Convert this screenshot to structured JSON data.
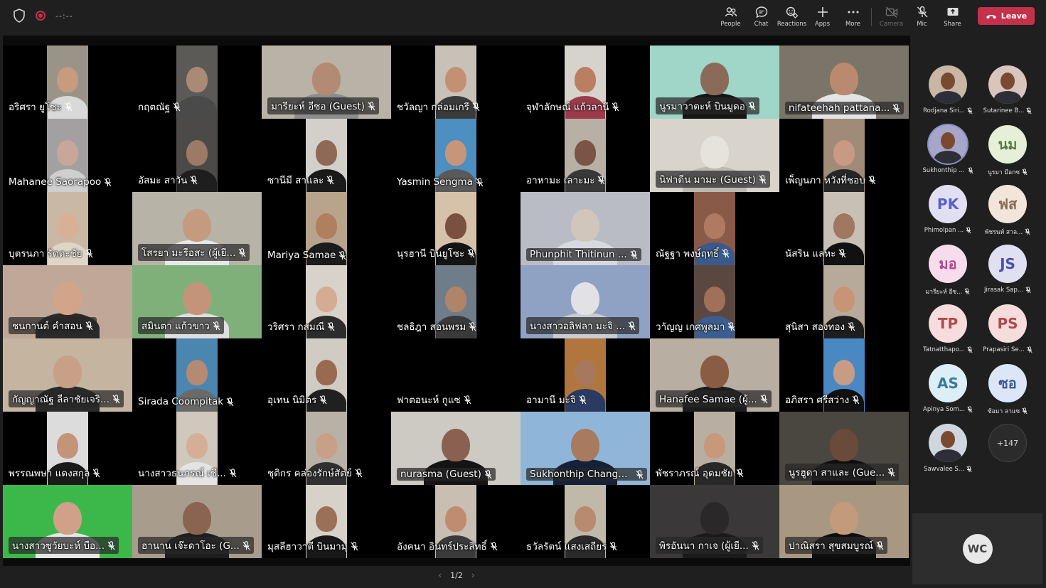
{
  "top_bar": {
    "timer": "--:--",
    "actions": [
      {
        "key": "people",
        "label": "People",
        "icon": "people-icon",
        "enabled": true
      },
      {
        "key": "chat",
        "label": "Chat",
        "icon": "chat-icon",
        "enabled": true
      },
      {
        "key": "reactions",
        "label": "Reactions",
        "icon": "reactions-icon",
        "enabled": true
      },
      {
        "key": "apps",
        "label": "Apps",
        "icon": "plus-icon",
        "enabled": true
      },
      {
        "key": "more",
        "label": "More",
        "icon": "more-icon",
        "enabled": true
      },
      {
        "key": "camera",
        "label": "Camera",
        "icon": "camera-off-icon",
        "enabled": false
      },
      {
        "key": "mic",
        "label": "Mic",
        "icon": "mic-off-icon",
        "enabled": true
      },
      {
        "key": "share",
        "label": "Share",
        "icon": "share-icon",
        "enabled": true
      }
    ],
    "leave_label": "Leave"
  },
  "colors": {
    "background": "#1f1f1f",
    "stage": "#0b0b0b",
    "leave": "#c4314b",
    "ring": "#8b8cc7"
  },
  "participants": [
    {
      "name": "อริศรา ยูโซะ",
      "wide": false,
      "bg": "#9a9488",
      "skin": "#c89a7e",
      "cloth": "#d9d9d9"
    },
    {
      "name": "กฤตณัฐ",
      "wide": false,
      "bg": "#5b5a57",
      "skin": "#a88a76",
      "cloth": "#4a4a4a"
    },
    {
      "name": "มารียะห์ อีซอ (Guest)",
      "wide": true,
      "bg": "#b9b2a6",
      "skin": "#b38a74",
      "cloth": "#8c8c8c"
    },
    {
      "name": "ชวัลญา กล่อมเกรี",
      "wide": false,
      "bg": "#c7c1b8",
      "skin": "#c49072",
      "cloth": "#3a3a3a"
    },
    {
      "name": "จุฬาลักษณ์ แก้วลานี",
      "wide": false,
      "bg": "#d6d2cc",
      "skin": "#b97f60",
      "cloth": "#9a3a4a"
    },
    {
      "name": "นูรมาวาตะห์ บินมูดอ",
      "wide": true,
      "bg": "#9fd6c8",
      "skin": "#8a6a58",
      "cloth": "#151515"
    },
    {
      "name": "nifateehah pattana...",
      "wide": true,
      "bg": "#7b7468",
      "skin": "#b98a70",
      "cloth": "#e4e4e4"
    },
    {
      "name": "Mahanee Saorapoo",
      "wide": false,
      "bg": "#a3a0a2",
      "skin": "#c8a79a",
      "cloth": "#cfcfcf"
    },
    {
      "name": "อัสมะ สาวัน",
      "wide": false,
      "bg": "#4c4a48",
      "skin": "#9c7a66",
      "cloth": "#1e1e1e"
    },
    {
      "name": "ซานีมี สาและ",
      "wide": false,
      "bg": "#d3d0cb",
      "skin": "#8e6a56",
      "cloth": "#1a1a1a"
    },
    {
      "name": "Yasmin Sengma",
      "wide": false,
      "bg": "#4c8fc0",
      "skin": "#c7967a",
      "cloth": "#5a5a5a"
    },
    {
      "name": "อาหามะ เลาะมะ",
      "wide": false,
      "bg": "#b8b0a4",
      "skin": "#7a5444",
      "cloth": "#383838"
    },
    {
      "name": "นิฟาดีน มามะ (Guest)",
      "wide": true,
      "bg": "#d8d4cc",
      "skin": "#e6e2dc",
      "cloth": "#bdb8b0"
    },
    {
      "name": "เพ็ญนภา หวังที่ชอบ",
      "wide": false,
      "bg": "#a08a78",
      "skin": "#c89a84",
      "cloth": "#262626"
    },
    {
      "name": "บุตรนภา รัตตะชัย",
      "wide": false,
      "bg": "#c8b8a4",
      "skin": "#d8b094",
      "cloth": "#e0d6c8"
    },
    {
      "name": "โสรยา มะรือสะ (ผู้เยี...",
      "wide": true,
      "bg": "#b7b3a6",
      "skin": "#c49a80",
      "cloth": "#e8e8e8"
    },
    {
      "name": "Mariya Samae",
      "wide": false,
      "bg": "#b8a48c",
      "skin": "#b0805e",
      "cloth": "#1c1c1c"
    },
    {
      "name": "นุรฮานี บินยูโซะ",
      "wide": false,
      "bg": "#d6c2a8",
      "skin": "#7a5040",
      "cloth": "#141414"
    },
    {
      "name": "Phunphit Thitinun ...",
      "wide": true,
      "bg": "#b9bcc4",
      "skin": "#d0c6bc",
      "cloth": "#d8d8e0"
    },
    {
      "name": "ณัฐฐา พงษ์ฤทธิ์",
      "wide": false,
      "bg": "#8a5a48",
      "skin": "#b07a62",
      "cloth": "#3a5a8a"
    },
    {
      "name": "นัสริน แลหะ",
      "wide": false,
      "bg": "#c8c0b4",
      "skin": "#a07860",
      "cloth": "#111111"
    },
    {
      "name": "ชนกานต์ คำสอน",
      "wide": true,
      "bg": "#c0a898",
      "skin": "#d2a48a",
      "cloth": "#2a2a2a"
    },
    {
      "name": "สมินตา แก้วขาว",
      "wide": true,
      "bg": "#7fb07a",
      "skin": "#c4947a",
      "cloth": "#dedede"
    },
    {
      "name": "วริศรา กสมณี",
      "wide": false,
      "bg": "#d8d2ca",
      "skin": "#d4ac94",
      "cloth": "#2c2c2c"
    },
    {
      "name": "ชลธิฎา สอนพรม",
      "wide": false,
      "bg": "#6f7d8a",
      "skin": "#b08468",
      "cloth": "#3a3a3a"
    },
    {
      "name": "นางสาวอลิฟลา มะจิ ...",
      "wide": true,
      "bg": "#8fa2c4",
      "skin": "#e2e2e6",
      "cloth": "#c8ccd4"
    },
    {
      "name": "วาัญญ เกศพูลมา",
      "wide": false,
      "bg": "#5a4840",
      "skin": "#a07058",
      "cloth": "#3b5e8f"
    },
    {
      "name": "สุนิสา สองทอง",
      "wide": false,
      "bg": "#b8aa9a",
      "skin": "#c89476",
      "cloth": "#1e1e1e"
    },
    {
      "name": "กัญญาณัฐ ลีลาชัยเจริ...",
      "wide": true,
      "bg": "#c4b4a0",
      "skin": "#c8a088",
      "cloth": "#2a2a2a"
    },
    {
      "name": "Sirada Coompitak",
      "wide": false,
      "bg": "#4a86b0",
      "skin": "#b48a72",
      "cloth": "#6a6a6a"
    },
    {
      "name": "อุเทน นิมิตร",
      "wide": false,
      "bg": "#d0ccc4",
      "skin": "#9a6a50",
      "cloth": "#202020"
    },
    {
      "name": "ฟาตอนะห์ กูแซ",
      "wide": false,
      "bg": "#000000",
      "skin": "#000000",
      "cloth": "#000000"
    },
    {
      "name": "อามานี มะจิ",
      "wide": false,
      "bg": "#b0763e",
      "skin": "#a8785e",
      "cloth": "#2a3a60"
    },
    {
      "name": "Hanafee Samae (ผู้...",
      "wide": true,
      "bg": "#b8aea2",
      "skin": "#8a5c44",
      "cloth": "#1c1c1c"
    },
    {
      "name": "อภิสรา ศรีสว่าง",
      "wide": false,
      "bg": "#4a88c4",
      "skin": "#c89c84",
      "cloth": "#101010"
    },
    {
      "name": "พรรณพษา แดงสกุล",
      "wide": false,
      "bg": "#dcdcdc",
      "skin": "#c49478",
      "cloth": "#1a1a1a"
    },
    {
      "name": "นางสาวธนภรณ์ เชี...",
      "wide": false,
      "bg": "#d0c8bc",
      "skin": "#d4ae96",
      "cloth": "#e4e4e4"
    },
    {
      "name": "ชุติกร คล่องรักษ์สัตย์",
      "wide": false,
      "bg": "#b8b2a6",
      "skin": "#c8a088",
      "cloth": "#303030"
    },
    {
      "name": "nurasma (Guest)",
      "wide": true,
      "bg": "#cdcac4",
      "skin": "#8a6050",
      "cloth": "#141414"
    },
    {
      "name": "Sukhonthip Changpr...",
      "wide": true,
      "bg": "#8fb6d8",
      "skin": "#a87a5e",
      "cloth": "#15203a"
    },
    {
      "name": "พัชราภรณ์ อุดมชัย",
      "wide": false,
      "bg": "#b9aea2",
      "skin": "#c8987c",
      "cloth": "#282828"
    },
    {
      "name": "นูรฮูดา สาและ (Gue...",
      "wide": true,
      "bg": "#4a4640",
      "skin": "#6a4a3a",
      "cloth": "#0e0e0e"
    },
    {
      "name": "นางสาวซูวัยบะห์ บือ...",
      "wide": true,
      "bg": "#3cb84a",
      "skin": "#d0a088",
      "cloth": "#e6e6e6"
    },
    {
      "name": "ฮานาน เจ๊ะดาโอะ (G...",
      "wide": true,
      "bg": "#a89c8c",
      "skin": "#8a6450",
      "cloth": "#1e1e1e"
    },
    {
      "name": "มุสลีฮาวาตี บินมามุ",
      "wide": false,
      "bg": "#d6d2ca",
      "skin": "#9a7058",
      "cloth": "#181818"
    },
    {
      "name": "อังคนา อินทร์ประสิทธิ์",
      "wide": false,
      "bg": "#c8beb2",
      "skin": "#c08c70",
      "cloth": "#3a3a3a"
    },
    {
      "name": "ธวัลรัตน์ แสงเสถียร",
      "wide": false,
      "bg": "#c0b8a8",
      "skin": "#b88a6e",
      "cloth": "#2a2a2a"
    },
    {
      "name": "พิรอันนา กาเจ (ผู้เยี...",
      "wide": true,
      "bg": "#3a3838",
      "skin": "#2a2828",
      "cloth": "#1a1a1a"
    },
    {
      "name": "ปาณิสรา สุขสมบูรณ์",
      "wide": true,
      "bg": "#a89882",
      "skin": "#c49a7c",
      "cloth": "#0e0e0e"
    }
  ],
  "pager": {
    "label": "1/2"
  },
  "side_panel": [
    {
      "name": "Rodjana Siri...",
      "initials": "",
      "photo": true,
      "bg": "#c9b6a5"
    },
    {
      "name": "Sutarinee B...",
      "initials": "",
      "photo": true,
      "bg": "#d8c6bc"
    },
    {
      "name": "Sukhonthip Cha...",
      "initials": "",
      "photo": true,
      "bg": "#a6a6c8",
      "ring": true
    },
    {
      "name": "นูรมา มีอกซ",
      "initials": "นม",
      "photo": false,
      "bg": "#e6efd8",
      "fg": "#5a7a3a"
    },
    {
      "name": "Phimolpan ...",
      "initials": "PK",
      "photo": false,
      "bg": "#e0e0f2",
      "fg": "#5b5fc7"
    },
    {
      "name": "พัชรนท์ สาล...",
      "initials": "ฟส",
      "photo": false,
      "bg": "#f2e6dc",
      "fg": "#8a6a50"
    },
    {
      "name": "มารียะห์ อีซ...",
      "initials": "มอ",
      "photo": false,
      "bg": "#f6dcec",
      "fg": "#b04a8a"
    },
    {
      "name": "Jirasak Sap...",
      "initials": "JS",
      "photo": false,
      "bg": "#e0e0f2",
      "fg": "#4a50a8"
    },
    {
      "name": "Tatnatthapo...",
      "initials": "TP",
      "photo": false,
      "bg": "#f6dcdc",
      "fg": "#b04a4a"
    },
    {
      "name": "Prapasiri Se...",
      "initials": "PS",
      "photo": false,
      "bg": "#f6dcdc",
      "fg": "#b04a4a"
    },
    {
      "name": "Apinya Som...",
      "initials": "AS",
      "photo": false,
      "bg": "#dceef6",
      "fg": "#3a7a9a"
    },
    {
      "name": "ซ้อมา ลาแซ",
      "initials": "ซอ",
      "photo": false,
      "bg": "#dce6f6",
      "fg": "#3a5a9a"
    },
    {
      "name": "Sawvalee S...",
      "initials": "",
      "photo": true,
      "bg": "#cfd6de"
    }
  ],
  "more_participants": "+147",
  "self_view": {
    "initials": "WC"
  }
}
